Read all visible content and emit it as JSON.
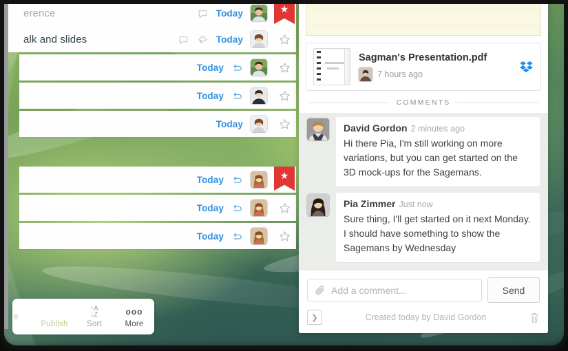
{
  "list": {
    "rows": [
      {
        "title": "erence",
        "dim": true,
        "offset": false,
        "icons": [
          "comment-icon"
        ],
        "date": "Today",
        "avatar": "man-outdoor",
        "flagged": true
      },
      {
        "title": "alk and slides",
        "dim": false,
        "offset": false,
        "icons": [
          "comment-icon",
          "tag-icon"
        ],
        "date": "Today",
        "avatar": "woman-short-hair",
        "flagged": false
      },
      {
        "title": "",
        "dim": false,
        "offset": true,
        "icons": [
          "repeat-icon"
        ],
        "date": "Today",
        "avatar": "man-outdoor",
        "flagged": false
      },
      {
        "title": "",
        "dim": false,
        "offset": true,
        "icons": [
          "repeat-icon"
        ],
        "date": "Today",
        "avatar": "person-dark",
        "flagged": false
      },
      {
        "title": "",
        "dim": false,
        "offset": true,
        "icons": [],
        "date": "Today",
        "avatar": "woman-short-hair",
        "flagged": false
      },
      {
        "title": "",
        "dim": false,
        "offset": true,
        "icons": [
          "repeat-icon"
        ],
        "date": "Today",
        "avatar": "woman-long-hair",
        "flagged": true
      },
      {
        "title": "",
        "dim": false,
        "offset": true,
        "icons": [
          "repeat-icon"
        ],
        "date": "Today",
        "avatar": "woman-long-hair",
        "flagged": false
      },
      {
        "title": "",
        "dim": false,
        "offset": true,
        "icons": [
          "repeat-icon"
        ],
        "date": "Today",
        "avatar": "woman-long-hair",
        "flagged": false
      }
    ]
  },
  "toolbar": {
    "cut_label": "e",
    "publish_label": "Publish",
    "sort_label": "Sort",
    "sort_glyph_top": "↑A",
    "sort_glyph_bottom": "↓Z",
    "more_label": "More",
    "more_glyph": "ooo"
  },
  "detail": {
    "attachment": {
      "name": "Sagman's Presentation.pdf",
      "time": "7 hours ago",
      "service_icon": "dropbox-icon",
      "service_color": "#1d8ceb"
    },
    "comments_divider": "COMMENTS",
    "comments": [
      {
        "author": "David Gordon",
        "time": "2 minutes ago",
        "text": "Hi there Pia, I'm still working on more variations, but you can get started on the 3D mock-ups for the Sagemans.",
        "avatar": "man-blond"
      },
      {
        "author": "Pia Zimmer",
        "time": "Just now",
        "text": "Sure thing, I'll get started on it next Monday. I should have something to show the Sagemans by Wednesday",
        "avatar": "woman-dark-hair"
      }
    ],
    "compose": {
      "placeholder": "Add a comment...",
      "send_label": "Send"
    },
    "footer": {
      "created": "Created today by David Gordon"
    }
  },
  "colors": {
    "accent_blue": "#2f90e0",
    "flag_red": "#e23636",
    "dropbox_blue": "#1d8ceb",
    "comment_bg": "#ebedea",
    "note_yellow": "#faf7e3"
  }
}
